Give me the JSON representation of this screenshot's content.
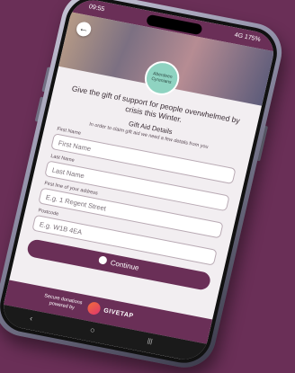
{
  "status": {
    "time": "09:55",
    "right": "4G 175%"
  },
  "header": {
    "back_icon": "arrow-left-icon"
  },
  "logo": {
    "text": "Aberdeen Cyrenians"
  },
  "content": {
    "headline": "Give the gift of support for people overwhelmed by crisis this Winter.",
    "section_title": "Gift Aid Details",
    "note": "In order to claim gift aid we need a few details from you"
  },
  "form": {
    "fields": [
      {
        "label": "First Name",
        "placeholder": "First Name"
      },
      {
        "label": "Last Name",
        "placeholder": "Last Name"
      },
      {
        "label": "First line of your address",
        "placeholder": "E.g. 1 Regent Street"
      },
      {
        "label": "Postcode",
        "placeholder": "E.g. W1B 4EA"
      }
    ],
    "continue_label": "Continue"
  },
  "footer": {
    "line1": "Secure donations",
    "line2": "powered by",
    "brand": "GIVETAP"
  },
  "nav": {
    "back": "‹",
    "home": "○",
    "recent": "|||"
  }
}
